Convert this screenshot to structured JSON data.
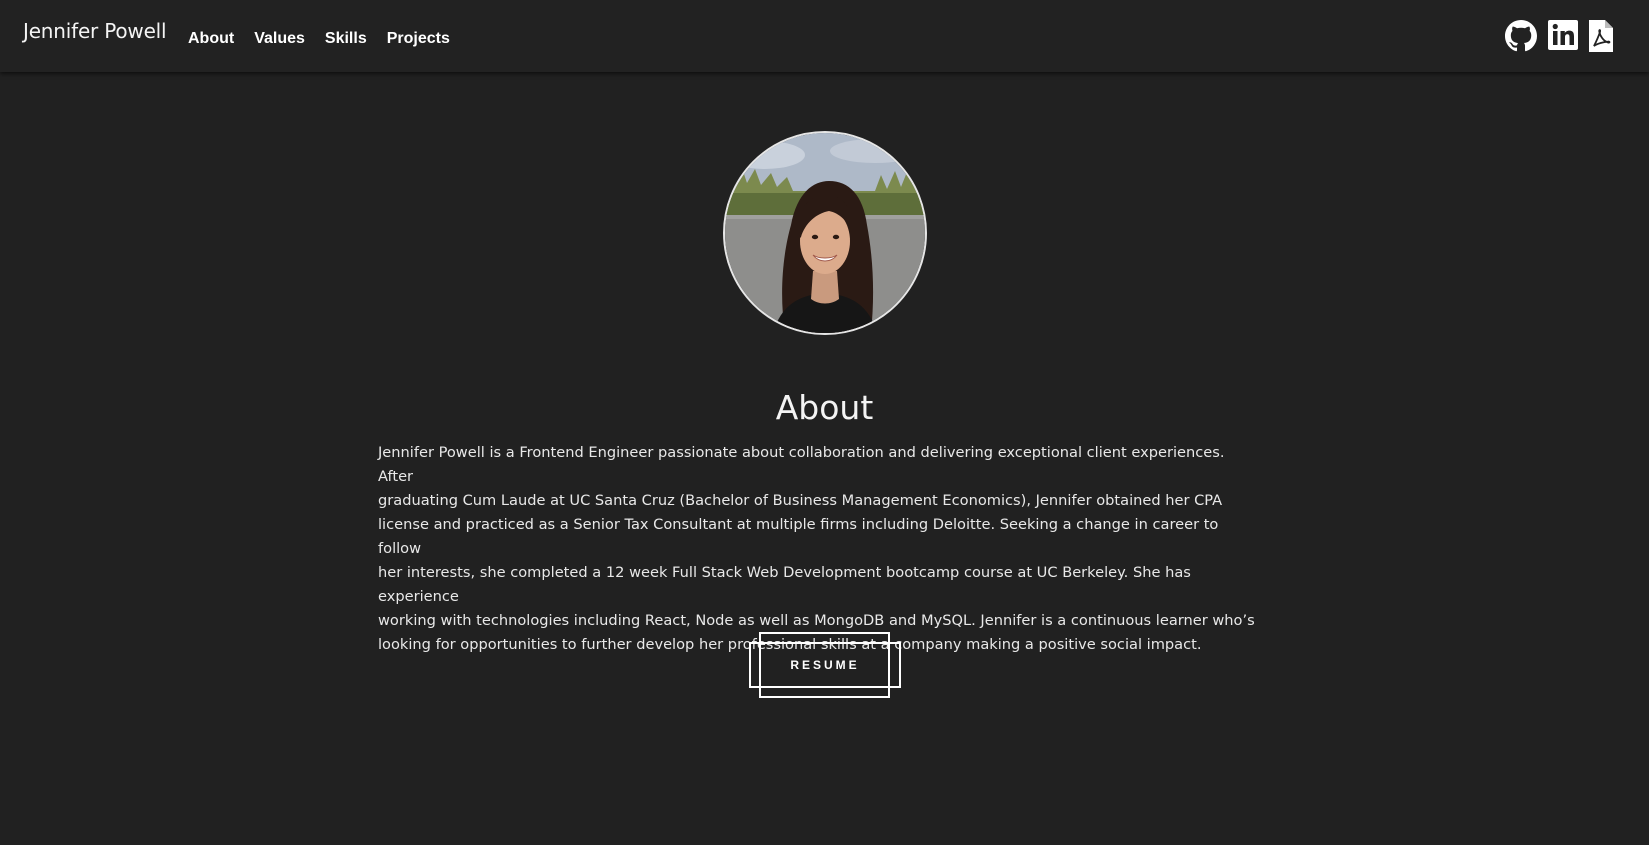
{
  "header": {
    "brand": "Jennifer Powell",
    "nav": [
      {
        "label": "About"
      },
      {
        "label": "Values"
      },
      {
        "label": "Skills"
      },
      {
        "label": "Projects"
      }
    ],
    "social_icons": [
      "github-icon",
      "linkedin-icon",
      "pdf-icon"
    ]
  },
  "about": {
    "photo_alt": "Jennifer Powell",
    "title": "About",
    "lines": [
      "Jennifer Powell is a Frontend Engineer passionate about collaboration and delivering exceptional client experiences. After",
      "graduating Cum Laude at UC Santa Cruz (Bachelor of Business Management Economics), Jennifer obtained her CPA",
      "license and practiced as a Senior Tax Consultant at multiple firms including Deloitte. Seeking a change in career to follow",
      "her interests, she completed a 12 week Full Stack Web Development bootcamp course at UC Berkeley. She has experience",
      "working with technologies including React, Node as well as MongoDB and MySQL. Jennifer is a continuous learner who’s",
      "looking for opportunities to further develop her professional skills at a company making a positive social impact."
    ],
    "resume_label": "RESUME"
  },
  "colors": {
    "background": "#212121",
    "navbar": "#222222",
    "text": "#ffffff"
  }
}
